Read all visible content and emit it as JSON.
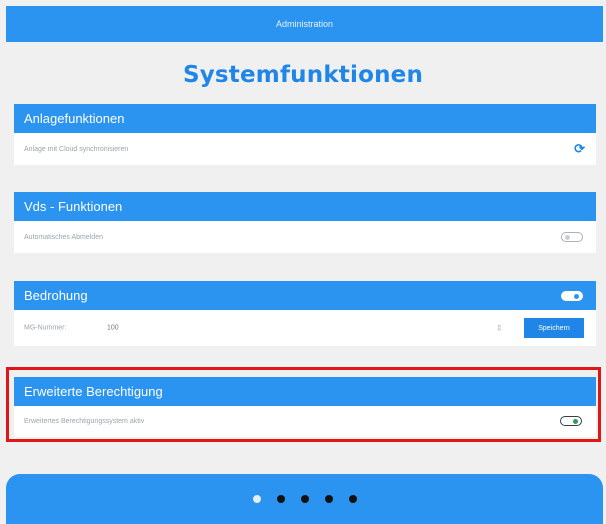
{
  "header": {
    "title": "Administration"
  },
  "page_title": "Systemfunktionen",
  "sections": {
    "anlage": {
      "title": "Anlagefunktionen",
      "row_label": "Anlage mit Cloud synchronisieren"
    },
    "vds": {
      "title": "Vds - Funktionen",
      "row_label": "Automatisches Abmelden",
      "toggle_state": "off"
    },
    "bedrohung": {
      "title": "Bedrohung",
      "toggle_state": "on",
      "mg_label": "MG-Nummer:",
      "mg_value": "100",
      "spin_glyph": "⇕",
      "save_label": "Speichern"
    },
    "erweitert": {
      "title": "Erweiterte Berechtigung",
      "row_label": "Erweitertes Berechtigungssystem aktiv",
      "toggle_state": "on"
    }
  },
  "icons": {
    "sync": "sync-icon"
  },
  "pagination": {
    "total": 5,
    "active_index": 0
  },
  "colors": {
    "accent": "#2b93f0",
    "title": "#1f86e8",
    "highlight": "#e01515",
    "toggle_active": "#2e9e52"
  }
}
